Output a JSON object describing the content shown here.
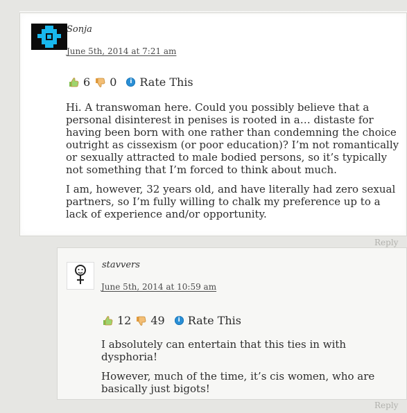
{
  "comments": [
    {
      "author": "Sonja",
      "date": "June 5th, 2014 at 7:21 am",
      "likes": "6",
      "dislikes": "0",
      "rate_label": "Rate This",
      "paragraphs": [
        "Hi. A transwoman here. Could you possibly believe that a personal disinterest in penises is rooted in a… distaste for having been born with one rather than condemning the choice outright as cissexism (or poor education)? I’m not romantically or sexually attracted to male bodied persons, so it’s typically not something that I’m forced to think about much.",
        "I am, however, 32 years old, and have literally had zero sexual partners, so I’m fully willing to chalk my preference up to a lack of experience and/or opportunity."
      ],
      "reply_label": "Reply",
      "avatar_icon": "pixel-avatar-icon"
    },
    {
      "author": "stavvers",
      "date": "June 5th, 2014 at 10:59 am",
      "likes": "12",
      "dislikes": "49",
      "rate_label": "Rate This",
      "paragraphs": [
        "I absolutely can entertain that this ties in with dysphoria!",
        "However, much of the time, it’s cis women, who are basically just bigots!"
      ],
      "reply_label": "Reply",
      "avatar_icon": "female-symbol-avatar-icon"
    }
  ],
  "colors": {
    "page_bg": "#e6e6e3",
    "outer_card_bg": "#ffffff",
    "inner_card_bg": "#f7f7f5",
    "info_icon": "#2a8fd6",
    "thumb_green": "#7fbe4e",
    "thumb_orange": "#e39a3b"
  }
}
